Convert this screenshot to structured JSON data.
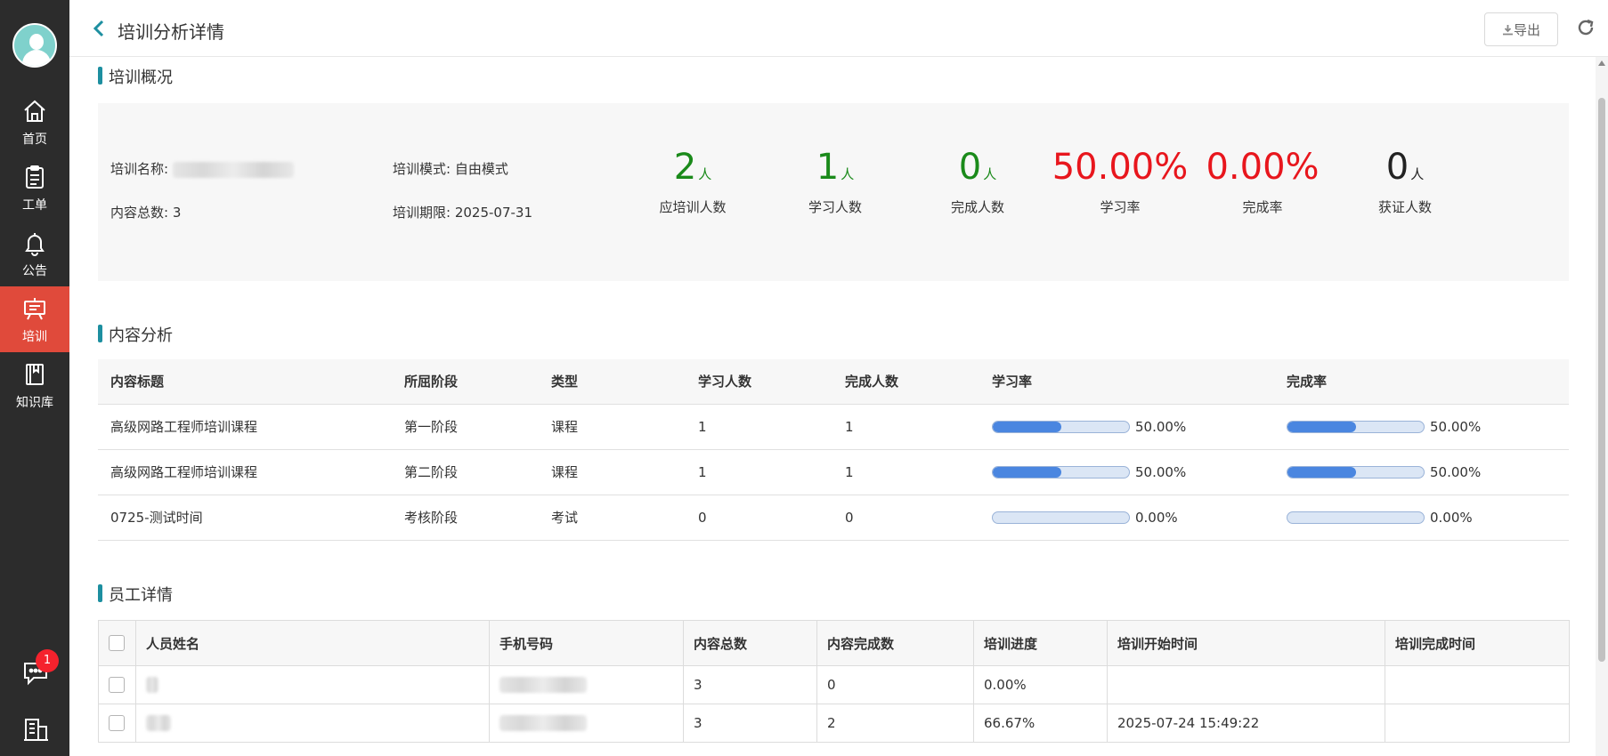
{
  "nav": {
    "items": [
      {
        "label": "首页",
        "icon": "home-icon"
      },
      {
        "label": "工单",
        "icon": "clipboard-icon"
      },
      {
        "label": "公告",
        "icon": "bell-icon"
      },
      {
        "label": "培训",
        "icon": "training-board-icon"
      },
      {
        "label": "知识库",
        "icon": "book-icon"
      }
    ],
    "message_badge": "1"
  },
  "header": {
    "title": "培训分析详情",
    "export_label": "导出"
  },
  "overview": {
    "section_title": "培训概况",
    "name_label": "培训名称:",
    "mode_label": "培训模式:",
    "mode_value": "自由模式",
    "total_label": "内容总数:",
    "total_value": "3",
    "deadline_label": "培训期限:",
    "deadline_value": "2025-07-31",
    "stats": [
      {
        "value": "2",
        "unit": "人",
        "caption": "应培训人数",
        "color": "#1a8a1a"
      },
      {
        "value": "1",
        "unit": "人",
        "caption": "学习人数",
        "color": "#1a8a1a"
      },
      {
        "value": "0",
        "unit": "人",
        "caption": "完成人数",
        "color": "#1a8a1a"
      },
      {
        "value": "50.00%",
        "unit": "",
        "caption": "学习率",
        "color": "#e8161d"
      },
      {
        "value": "0.00%",
        "unit": "",
        "caption": "完成率",
        "color": "#e8161d"
      },
      {
        "value": "0",
        "unit": "人",
        "caption": "获证人数",
        "color": "#222222"
      }
    ]
  },
  "content": {
    "section_title": "内容分析",
    "headers": [
      "内容标题",
      "所屈阶段",
      "类型",
      "学习人数",
      "完成人数",
      "学习率",
      "完成率"
    ],
    "rows": [
      {
        "title": "高级网路工程师培训课程",
        "stage": "第一阶段",
        "type": "课程",
        "learners": "1",
        "completed": "1",
        "learn_rate": 0.5,
        "learn_rate_label": "50.00%",
        "complete_rate": 0.5,
        "complete_rate_label": "50.00%"
      },
      {
        "title": "高级网路工程师培训课程",
        "stage": "第二阶段",
        "type": "课程",
        "learners": "1",
        "completed": "1",
        "learn_rate": 0.5,
        "learn_rate_label": "50.00%",
        "complete_rate": 0.5,
        "complete_rate_label": "50.00%"
      },
      {
        "title": "0725-测试时间",
        "stage": "考核阶段",
        "type": "考试",
        "learners": "0",
        "completed": "0",
        "learn_rate": 0,
        "learn_rate_label": "0.00%",
        "complete_rate": 0,
        "complete_rate_label": "0.00%"
      }
    ]
  },
  "employees": {
    "section_title": "员工详情",
    "headers": [
      "人员姓名",
      "手机号码",
      "内容总数",
      "内容完成数",
      "培训进度",
      "培训开始时间",
      "培训完成时间"
    ],
    "rows": [
      {
        "total": "3",
        "done": "0",
        "progress": "0.00%",
        "start": "",
        "end": ""
      },
      {
        "total": "3",
        "done": "2",
        "progress": "66.67%",
        "start": "2025-07-24 15:49:22",
        "end": ""
      }
    ]
  }
}
